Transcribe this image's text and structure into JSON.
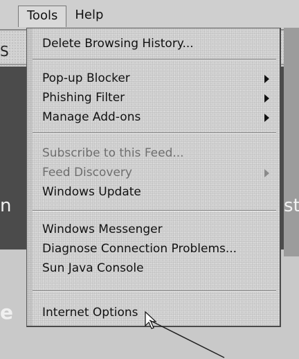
{
  "menubar": {
    "items": [
      {
        "label": "Tools",
        "open": true
      },
      {
        "label": "Help",
        "open": false
      }
    ]
  },
  "background": {
    "address_fragment": "S",
    "left_fragment": "n",
    "right_fragment": "st",
    "left_bottom_fragment": "e"
  },
  "tools_menu": {
    "items": [
      {
        "label": "Delete Browsing History...",
        "enabled": true,
        "submenu": false
      },
      {
        "label": "Pop-up Blocker",
        "enabled": true,
        "submenu": true
      },
      {
        "label": "Phishing Filter",
        "enabled": true,
        "submenu": true
      },
      {
        "label": "Manage Add-ons",
        "enabled": true,
        "submenu": true
      },
      {
        "label": "Subscribe to this Feed...",
        "enabled": false,
        "submenu": false
      },
      {
        "label": "Feed Discovery",
        "enabled": false,
        "submenu": true
      },
      {
        "label": "Windows Update",
        "enabled": true,
        "submenu": false
      },
      {
        "label": "Windows Messenger",
        "enabled": true,
        "submenu": false
      },
      {
        "label": "Diagnose Connection Problems...",
        "enabled": true,
        "submenu": false
      },
      {
        "label": "Sun Java Console",
        "enabled": true,
        "submenu": false
      },
      {
        "label": "Internet Options",
        "enabled": true,
        "submenu": false,
        "hovered": true
      }
    ]
  },
  "icons": {
    "cursor": "mouse-pointer-icon",
    "submenu": "chevron-right-icon"
  }
}
